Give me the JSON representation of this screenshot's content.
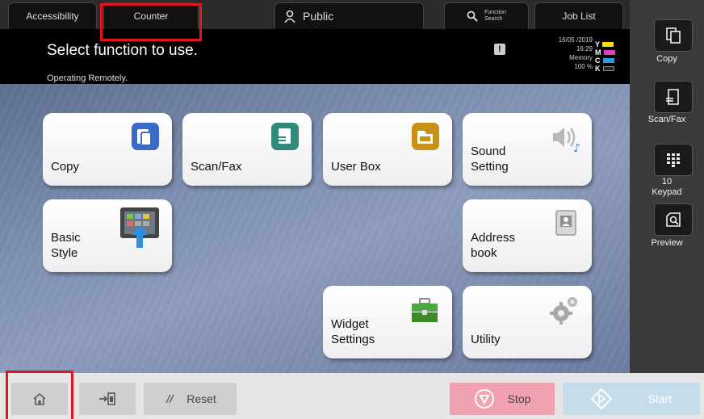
{
  "tabs": {
    "accessibility": "Accessibility",
    "counter": "Counter",
    "public": "Public",
    "function_search_line1": "Function",
    "function_search_line2": "Search",
    "job_list": "Job List"
  },
  "status": {
    "title": "Select function to use.",
    "subtitle": "Operating Remotely.",
    "alert": "!",
    "date": "16/05 /2019",
    "time": "16:29",
    "memory_label": "Memory",
    "memory_value": "100 %",
    "toner": [
      {
        "letter": "Y",
        "color": "#f5e000"
      },
      {
        "letter": "M",
        "color": "#e040c0"
      },
      {
        "letter": "C",
        "color": "#2a9ee0"
      },
      {
        "letter": "K",
        "color": "#222222"
      }
    ]
  },
  "tiles": {
    "copy": "Copy",
    "scan_fax": "Scan/Fax",
    "user_box": "User Box",
    "sound_setting": "Sound\nSetting",
    "basic_style": "Basic\nStyle",
    "address_book": "Address\nbook",
    "widget_settings": "Widget\nSettings",
    "utility": "Utility"
  },
  "sidebar": {
    "copy": "Copy",
    "scan_fax": "Scan/Fax",
    "keypad_line1": "10",
    "keypad_line2": "Keypad",
    "preview": "Preview"
  },
  "bottom": {
    "reset": "Reset",
    "stop": "Stop",
    "start": "Start"
  },
  "colors": {
    "highlight": "#e0151e",
    "stop_bg": "#f1a2b0",
    "start_bg": "#c5dde9"
  }
}
